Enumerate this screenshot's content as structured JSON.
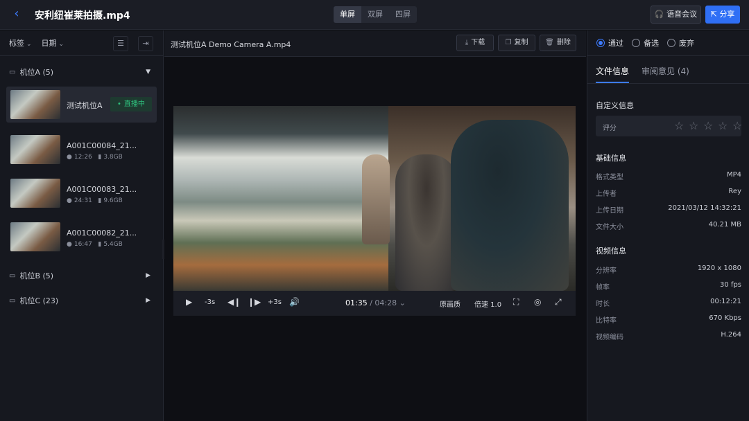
{
  "header": {
    "title": "安利纽崔莱拍摄.mp4",
    "view_modes": [
      "单屏",
      "双屏",
      "四屏"
    ],
    "active_view": "单屏",
    "voice_label": "语音会议",
    "share_label": "分享"
  },
  "left": {
    "filters": [
      "标签",
      "日期"
    ],
    "groups": [
      {
        "name": "机位A (5)",
        "items": [
          {
            "name": "测试机位A",
            "status": "直播中"
          },
          {
            "name": "A001C00084_21...",
            "duration": "12:26",
            "size": "3.8GB"
          },
          {
            "name": "A001C00083_21...",
            "duration": "24:31",
            "size": "9.6GB"
          },
          {
            "name": "A001C00082_21...",
            "duration": "16:47",
            "size": "5.4GB"
          }
        ]
      },
      {
        "name": "机位B (5)"
      },
      {
        "name": "机位C (23)"
      }
    ]
  },
  "center": {
    "file_name": "测试机位A Demo Camera A.mp4",
    "download_label": "下载",
    "copy_label": "复制",
    "delete_label": "删除",
    "player": {
      "back_label": "-3s",
      "forward_label": "+3s",
      "current_time": "01:35",
      "separator": "/",
      "total_time": "04:28",
      "quality_label": "原画质",
      "speed_label": "倍速 1.0"
    }
  },
  "right": {
    "radios": [
      {
        "label": "通过",
        "selected": true
      },
      {
        "label": "备选",
        "selected": false
      },
      {
        "label": "废弃",
        "selected": false
      }
    ],
    "tabs": [
      {
        "label": "文件信息",
        "active": true
      },
      {
        "label": "审阅意见 (4)",
        "active": false
      }
    ],
    "custom_info_title": "自定义信息",
    "rating_label": "评分",
    "rating_value": 0,
    "rating_max": 5,
    "basic_title": "基础信息",
    "basic": [
      {
        "k": "格式类型",
        "v": "MP4"
      },
      {
        "k": "上传者",
        "v": "Rey"
      },
      {
        "k": "上传日期",
        "v": "2021/03/12 14:32:21"
      },
      {
        "k": "文件大小",
        "v": "40.21 MB"
      }
    ],
    "video_title": "视频信息",
    "video": [
      {
        "k": "分辨率",
        "v": "1920 x 1080"
      },
      {
        "k": "帧率",
        "v": "30 fps"
      },
      {
        "k": "时长",
        "v": "00:12:21"
      },
      {
        "k": "比特率",
        "v": "670 Kbps"
      },
      {
        "k": "视频编码",
        "v": "H.264"
      }
    ]
  },
  "colors": {
    "accent": "#2f6ff5",
    "live": "#2ec27e",
    "background": "#0e0f14",
    "panel": "#16181f"
  },
  "icons": [
    "back-chevron-icon",
    "headset-icon",
    "share-icon",
    "camera-icon",
    "chevron-down-icon",
    "chevron-right-icon",
    "sort-icon",
    "export-icon",
    "download-icon",
    "copy-icon",
    "trash-icon",
    "play-icon",
    "step-back-icon",
    "step-forward-icon",
    "volume-icon",
    "fit-screen-icon",
    "settings-icon",
    "fullscreen-icon",
    "star-icon",
    "clock-icon",
    "file-icon"
  ]
}
